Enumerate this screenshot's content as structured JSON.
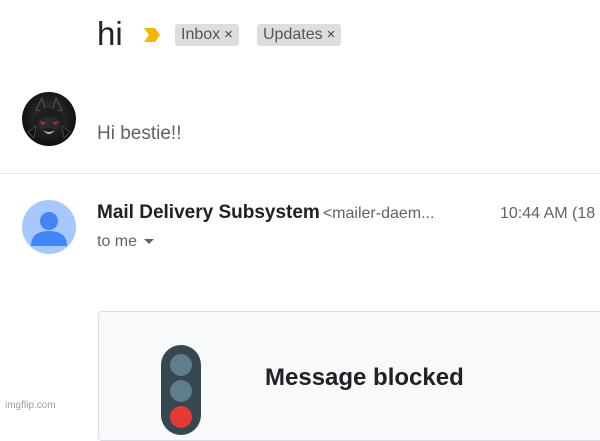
{
  "thread": {
    "subject": "hi",
    "labels": [
      {
        "name": "Inbox",
        "close": "×"
      },
      {
        "name": "Updates",
        "close": "×"
      }
    ],
    "importance_icon": "label-important-icon",
    "colors": {
      "importance": "#f4b400",
      "label_bg": "#dddddd"
    }
  },
  "messages": [
    {
      "avatar_icon": "avatar-shadow-icon",
      "snippet": "Hi bestie!!"
    },
    {
      "avatar_icon": "default-person-avatar-icon",
      "sender_name": "Mail Delivery Subsystem",
      "sender_email": "<mailer-daem...",
      "timestamp": "10:44 AM (18",
      "recipient": "to me",
      "card": {
        "icon": "traffic-light-icon",
        "title": "Message blocked"
      }
    }
  ],
  "watermark": "imgflip.com"
}
